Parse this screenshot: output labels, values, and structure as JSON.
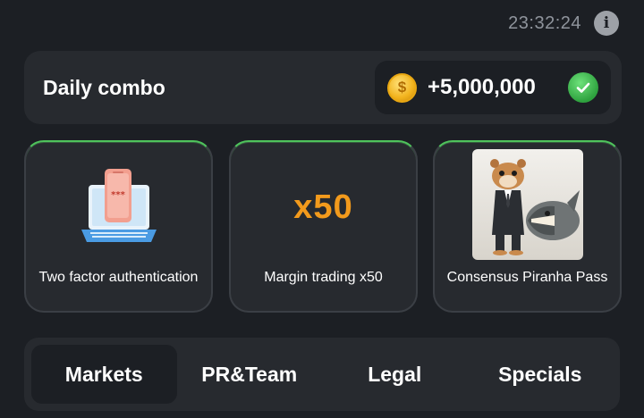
{
  "header": {
    "time": "23:32:24",
    "info_icon": "info-icon"
  },
  "combo": {
    "title": "Daily combo",
    "reward": "+5,000,000",
    "coin_icon": "coin-icon",
    "check_icon": "check-icon"
  },
  "cards": [
    {
      "label": "Two factor authentication",
      "icon": "laptop-phone-icon"
    },
    {
      "label": "Margin trading x50",
      "art_text": "x50"
    },
    {
      "label": "Consensus Piranha Pass",
      "icon": "hamster-piranha-image"
    }
  ],
  "tabs": [
    {
      "label": "Markets",
      "active": true
    },
    {
      "label": "PR&Team",
      "active": false
    },
    {
      "label": "Legal",
      "active": false
    },
    {
      "label": "Specials",
      "active": false
    }
  ],
  "colors": {
    "background": "#1c1f24",
    "panel": "#272a2f",
    "accent_green": "#4fc35c",
    "accent_orange": "#f29a1c",
    "coin_gold": "#f1b21c"
  }
}
